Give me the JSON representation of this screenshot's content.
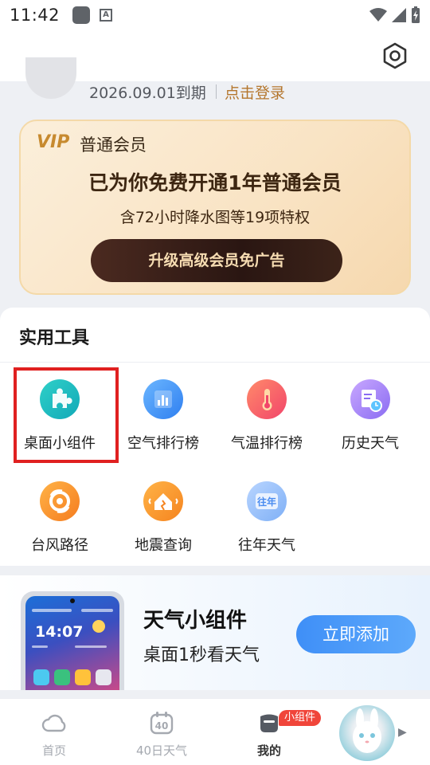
{
  "status_bar": {
    "time": "11:42",
    "notification_icons": [
      "app-icon",
      "text-a-icon"
    ],
    "right_icons": [
      "wifi-icon",
      "signal-icon",
      "battery-icon"
    ],
    "ic2_letter": "A"
  },
  "header": {
    "settings_icon": "gear-icon"
  },
  "profile": {
    "expiry": "2026.09.01到期",
    "login_link": "点击登录"
  },
  "vip_card": {
    "logo": "VIP",
    "label": "普通会员",
    "headline": "已为你免费开通1年普通会员",
    "subtitle": "含72小时降水图等19项特权",
    "button": "升级高级会员免广告"
  },
  "tools": {
    "title": "实用工具",
    "items": [
      {
        "label": "桌面小组件",
        "icon": "puzzle-icon"
      },
      {
        "label": "空气排行榜",
        "icon": "bar-chart-icon"
      },
      {
        "label": "气温排行榜",
        "icon": "thermometer-icon"
      },
      {
        "label": "历史天气",
        "icon": "calendar-clock-icon"
      },
      {
        "label": "台风路径",
        "icon": "typhoon-icon"
      },
      {
        "label": "地震查询",
        "icon": "earthquake-icon"
      },
      {
        "label": "往年天气",
        "icon": "past-years-icon",
        "icon_text": "往年"
      }
    ]
  },
  "promo": {
    "phone_time": "14:07",
    "title": "天气小组件",
    "subtitle": "桌面1秒看天气",
    "button": "立即添加"
  },
  "bottom_nav": {
    "items": [
      {
        "label": "首页",
        "icon": "cloud-icon"
      },
      {
        "label": "40日天气",
        "icon": "calendar-40-icon",
        "icon_text": "40"
      },
      {
        "label": "我的",
        "icon": "profile-icon"
      }
    ],
    "badge": "小组件"
  },
  "colors": {
    "accent_blue": "#3f8ff7",
    "vip_gold": "#c78a2f",
    "highlight_red": "#e02020",
    "badge_red": "#f0453a"
  }
}
